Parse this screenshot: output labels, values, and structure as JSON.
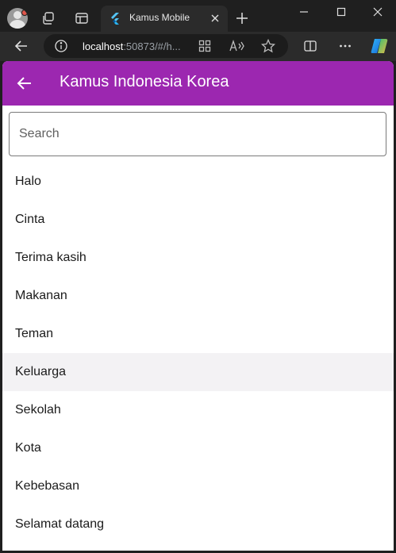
{
  "browser": {
    "tab": {
      "title": "Kamus Mobile",
      "favicon": "flutter-icon"
    },
    "address": {
      "host": "localhost",
      "rest": ":50873/#/h..."
    },
    "icons": [
      "profile-avatar-icon",
      "workspaces-icon",
      "tab-actions-icon",
      "close-tab-icon",
      "new-tab-icon",
      "minimize-icon",
      "maximize-icon",
      "close-window-icon",
      "back-icon",
      "site-info-icon",
      "app-available-icon",
      "read-aloud-icon",
      "favorite-star-icon",
      "split-screen-icon",
      "more-menu-icon",
      "copilot-icon"
    ]
  },
  "app": {
    "title": "Kamus Indonesia Korea",
    "accent_color": "#9c27b0",
    "search": {
      "placeholder": "Search",
      "value": ""
    },
    "words": [
      "Halo",
      "Cinta",
      "Terima kasih",
      "Makanan",
      "Teman",
      "Keluarga",
      "Sekolah",
      "Kota",
      "Kebebasan",
      "Selamat datang"
    ],
    "hovered_word": "Keluarga"
  }
}
